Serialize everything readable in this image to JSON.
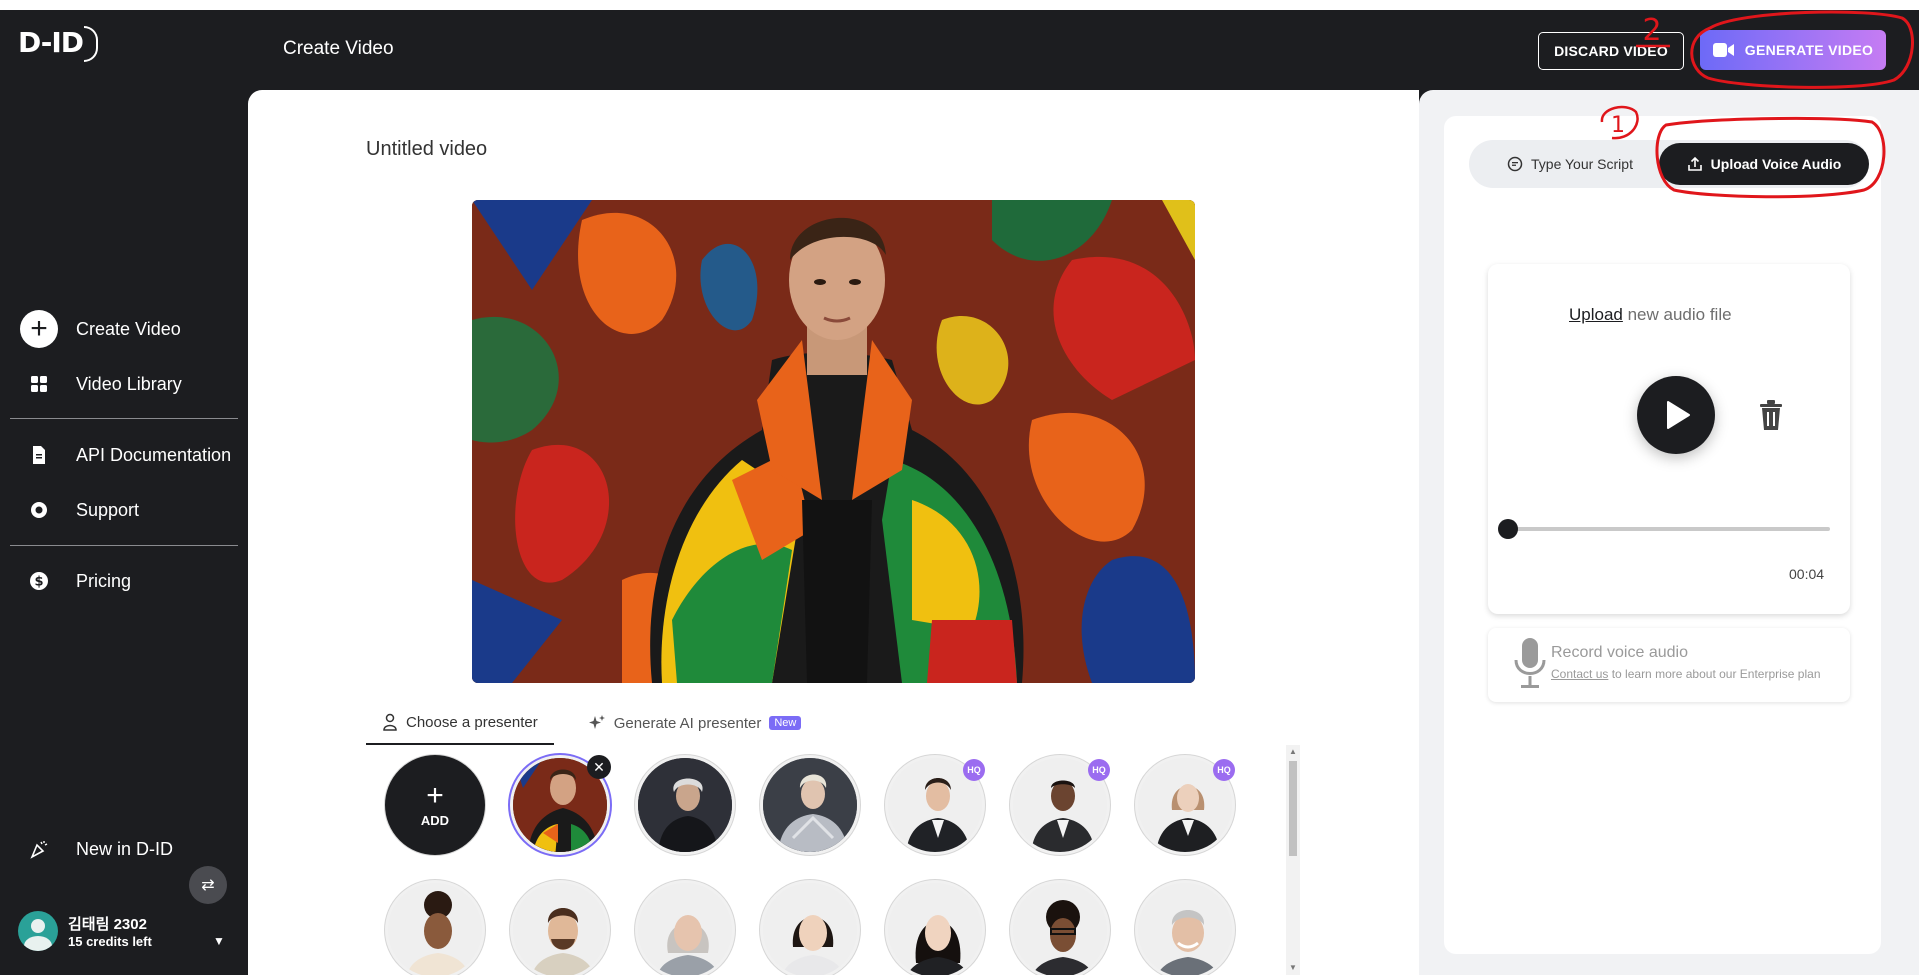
{
  "app": {
    "logo_text": "D-ID"
  },
  "header": {
    "title": "Create Video",
    "discard_label": "DISCARD VIDEO",
    "generate_label": "GENERATE VIDEO"
  },
  "sidebar": {
    "items": [
      {
        "label": "Create Video",
        "icon": "plus-icon"
      },
      {
        "label": "Video Library",
        "icon": "grid-icon"
      },
      {
        "label": "API Documentation",
        "icon": "document-icon"
      },
      {
        "label": "Support",
        "icon": "lifebuoy-icon"
      },
      {
        "label": "Pricing",
        "icon": "dollar-icon"
      },
      {
        "label": "New in D-ID",
        "icon": "party-icon"
      }
    ],
    "user": {
      "name": "김태림 2302",
      "credits": "15 credits left"
    }
  },
  "main": {
    "video_title": "Untitled video",
    "tabs": [
      {
        "label": "Choose a presenter"
      },
      {
        "label": "Generate AI presenter",
        "badge": "New"
      }
    ],
    "add_label": "ADD",
    "hq_label": "HQ"
  },
  "right": {
    "script_tab": "Type Your Script",
    "audio_tab": "Upload Voice Audio",
    "upload_link": "Upload",
    "upload_rest": " new audio file",
    "duration": "00:04",
    "record_title": "Record voice audio",
    "record_link": "Contact us",
    "record_rest": " to learn more about our Enterprise plan"
  },
  "annotations": {
    "mark_1": "1",
    "mark_2": "2"
  },
  "colors": {
    "accent_start": "#6d6af7",
    "accent_end": "#c67cf3",
    "sidebar_bg": "#1c1d20",
    "annotation": "#e0161b"
  }
}
